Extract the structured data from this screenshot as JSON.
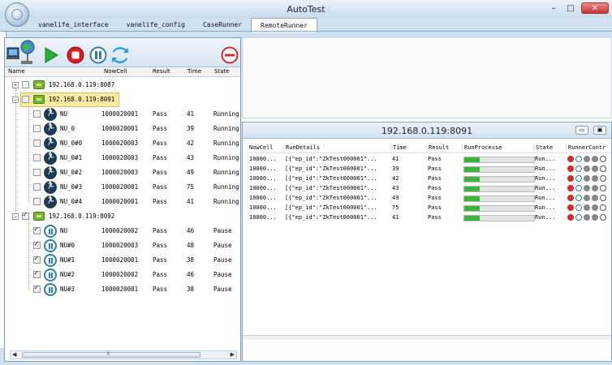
{
  "window": {
    "title": "AutoTest",
    "minimize_glyph": "–",
    "restore_glyph": "□",
    "close_glyph": "✕"
  },
  "tabs": [
    {
      "label": "vanelife_interface"
    },
    {
      "label": "vanelife_config"
    },
    {
      "label": "CaseRunner"
    },
    {
      "label": "RemoteRunner"
    }
  ],
  "left_panel": {
    "toolbar_icons": [
      "network-globe-icon",
      "play-icon",
      "stop-icon",
      "pause-icon",
      "refresh-icon",
      "remove-icon"
    ],
    "columns": {
      "name": "Name",
      "nowcell": "NowCell",
      "result": "Result",
      "time": "Time",
      "state": "State"
    },
    "groups": [
      {
        "host": "192.168.0.119:8087",
        "expander": "+",
        "checked": false,
        "items": []
      },
      {
        "host": "192.168.0.119:8091",
        "expander": "–",
        "checked": false,
        "selected": true,
        "items": [
          {
            "name": "NU",
            "nowcell": "1000020001",
            "result": "Pass",
            "time": "41",
            "state": "Running"
          },
          {
            "name": "NU_0",
            "nowcell": "1000020001",
            "result": "Pass",
            "time": "39",
            "state": "Running"
          },
          {
            "name": "NU_0#0",
            "nowcell": "1000020003",
            "result": "Pass",
            "time": "42",
            "state": "Running"
          },
          {
            "name": "NU_0#1",
            "nowcell": "1000020003",
            "result": "Pass",
            "time": "43",
            "state": "Running"
          },
          {
            "name": "NU_0#2",
            "nowcell": "1000020003",
            "result": "Pass",
            "time": "49",
            "state": "Running"
          },
          {
            "name": "NU_0#3",
            "nowcell": "1000020001",
            "result": "Pass",
            "time": "75",
            "state": "Running"
          },
          {
            "name": "NU_0#4",
            "nowcell": "1000020001",
            "result": "Pass",
            "time": "41",
            "state": "Running"
          }
        ]
      },
      {
        "host": "192.168.0.119:8092",
        "expander": "–",
        "checked": true,
        "items": [
          {
            "name": "NU",
            "nowcell": "1000020002",
            "result": "Pass",
            "time": "46",
            "state": "Pause"
          },
          {
            "name": "NU#0",
            "nowcell": "1000020003",
            "result": "Pass",
            "time": "48",
            "state": "Pause"
          },
          {
            "name": "NU#1",
            "nowcell": "1000020001",
            "result": "Pass",
            "time": "38",
            "state": "Pause"
          },
          {
            "name": "NU#2",
            "nowcell": "1000020002",
            "result": "Pass",
            "time": "46",
            "state": "Pause"
          },
          {
            "name": "NU#3",
            "nowcell": "1000020001",
            "result": "Pass",
            "time": "38",
            "state": "Pause"
          }
        ]
      }
    ],
    "scroll_left_glyph": "◀",
    "scroll_right_glyph": "▶",
    "scroll_thumb_glyph": "⦀"
  },
  "right_panel": {
    "title": "192.168.0.119:8091",
    "restore_glyph": "▭",
    "close_glyph": "▣",
    "columns": {
      "nowcell": "NowCell",
      "details": "RunDetails",
      "time": "Time",
      "result": "Result",
      "process": "RunProcesse",
      "state": "State",
      "controls": "RunnerContr"
    },
    "rows": [
      {
        "nowcell": "10000...",
        "details": "[{\"ep_id\":\"ZkTest000001\"...",
        "time": "41",
        "result": "Pass",
        "progress": 0.22,
        "state": "Run..."
      },
      {
        "nowcell": "10000...",
        "details": "[{\"ep_id\":\"ZkTest000001\"...",
        "time": "39",
        "result": "Pass",
        "progress": 0.22,
        "state": "Run..."
      },
      {
        "nowcell": "10000...",
        "details": "[{\"ep_id\":\"ZkTest000001\"...",
        "time": "42",
        "result": "Pass",
        "progress": 0.22,
        "state": "Run..."
      },
      {
        "nowcell": "10000...",
        "details": "[{\"ep_id\":\"ZkTest000001\"...",
        "time": "43",
        "result": "Pass",
        "progress": 0.22,
        "state": "Run..."
      },
      {
        "nowcell": "10000...",
        "details": "[{\"ep_id\":\"ZkTest000001\"...",
        "time": "49",
        "result": "Pass",
        "progress": 0.22,
        "state": "Run..."
      },
      {
        "nowcell": "10000...",
        "details": "[{\"ep_id\":\"ZkTest000001\"...",
        "time": "75",
        "result": "Pass",
        "progress": 0.22,
        "state": "Run..."
      },
      {
        "nowcell": "10000...",
        "details": "[{\"ep_id\":\"ZkTest000001\"...",
        "time": "41",
        "result": "Pass",
        "progress": 0.22,
        "state": "Run..."
      }
    ]
  },
  "colors": {
    "accent": "#2f7fa8",
    "progress": "#3cb53c",
    "stop": "#d42a2a",
    "selected_row": "#fbe9a6"
  }
}
